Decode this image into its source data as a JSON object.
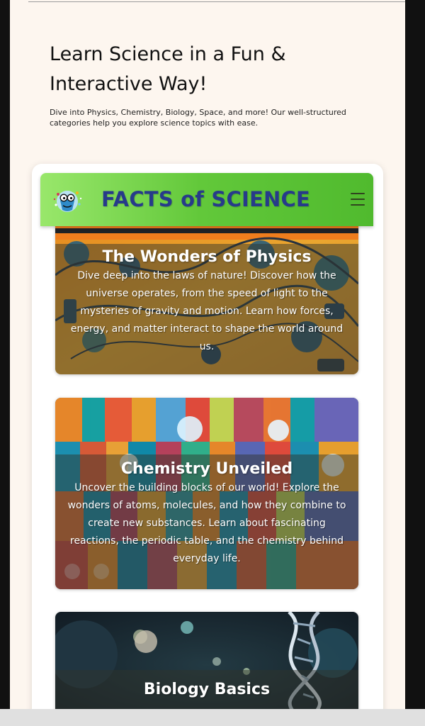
{
  "hero": {
    "title": "Learn Science in a Fun & Interactive Way!",
    "description": "Dive into Physics, Chemistry, Biology, Space, and more! Our well-structured categories help you explore science topics with ease."
  },
  "app": {
    "brand": "FACTS of SCIENCE",
    "logo_icon": "science-character-icon",
    "menu_icon": "hamburger-icon",
    "bar_color": "#62c83a",
    "brand_color": "#273b8a"
  },
  "cards": [
    {
      "title": "The Wonders of Physics",
      "text": "Dive deep into the laws of nature! Discover how the universe operates, from the speed of light to the mysteries of gravity and motion. Learn how forces, energy, and matter interact to shape the world around us."
    },
    {
      "title": "Chemistry Unveiled",
      "text": "Uncover the building blocks of our world! Explore the wonders of atoms, molecules, and how they combine to create new substances. Learn about fascinating reactions, the periodic table, and the chemistry behind everyday life."
    },
    {
      "title": "Biology Basics",
      "text": ""
    }
  ]
}
